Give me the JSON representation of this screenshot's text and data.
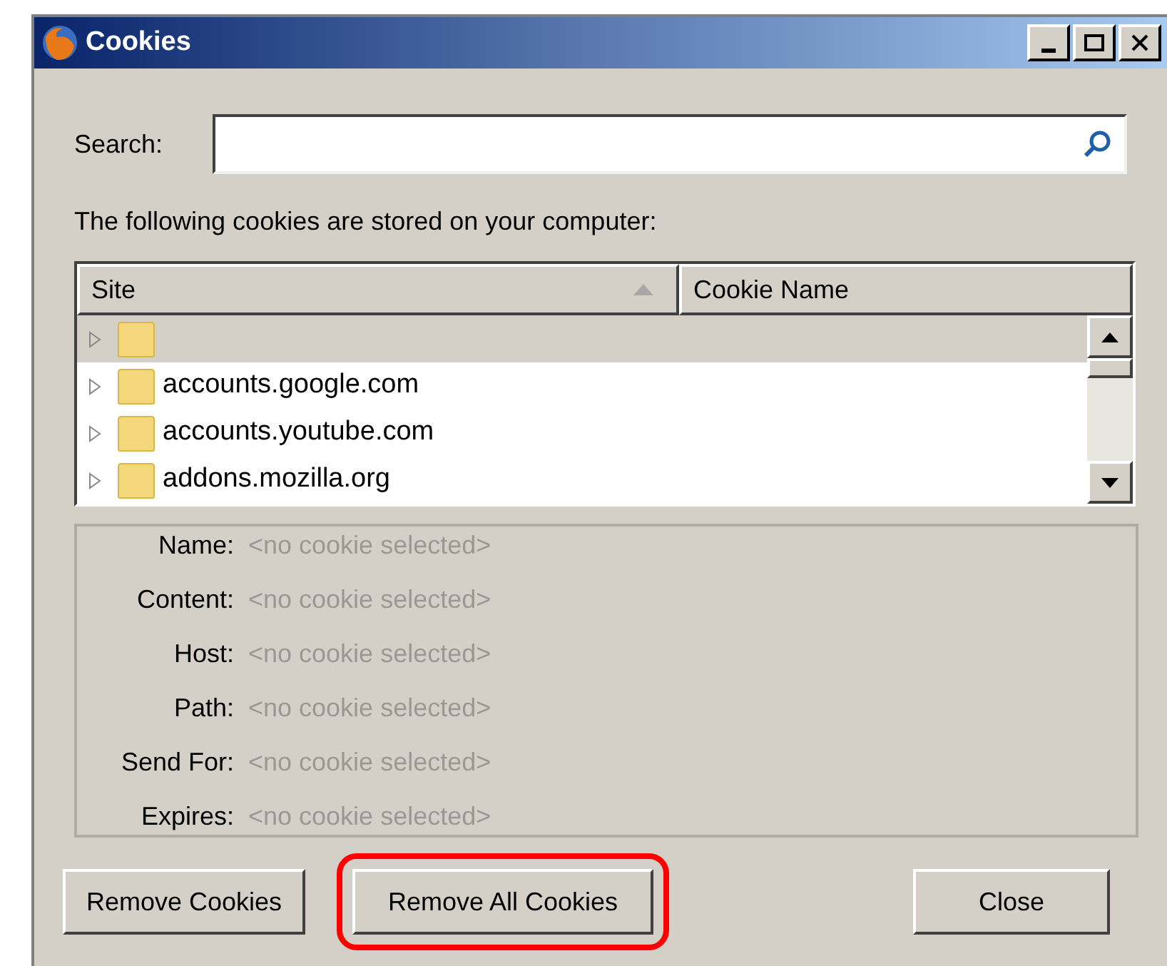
{
  "window": {
    "title": "Cookies"
  },
  "search": {
    "label": "Search:"
  },
  "intro": "The following cookies are stored on your computer:",
  "tree": {
    "columns": [
      {
        "label": "Site",
        "sorted": true
      },
      {
        "label": "Cookie Name",
        "sorted": false
      }
    ],
    "rows": [
      {
        "site": "",
        "selected": true,
        "expanded": false
      },
      {
        "site": "accounts.google.com",
        "selected": false,
        "expanded": false
      },
      {
        "site": "accounts.youtube.com",
        "selected": false,
        "expanded": false
      },
      {
        "site": "addons.mozilla.org",
        "selected": false,
        "expanded": false
      }
    ]
  },
  "details": [
    {
      "label": "Name:",
      "value": "<no cookie selected>"
    },
    {
      "label": "Content:",
      "value": "<no cookie selected>"
    },
    {
      "label": "Host:",
      "value": "<no cookie selected>"
    },
    {
      "label": "Path:",
      "value": "<no cookie selected>"
    },
    {
      "label": "Send For:",
      "value": "<no cookie selected>"
    },
    {
      "label": "Expires:",
      "value": "<no cookie selected>"
    }
  ],
  "buttons": [
    {
      "label": "Remove Cookies",
      "highlighted": false
    },
    {
      "label": "Remove All Cookies",
      "highlighted": true
    },
    {
      "label": "Close",
      "highlighted": false
    }
  ]
}
